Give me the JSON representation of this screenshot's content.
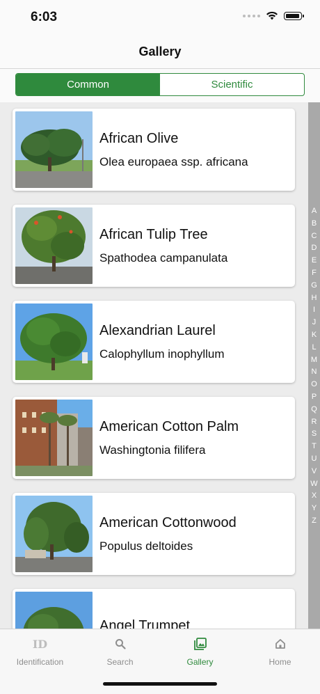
{
  "status": {
    "time": "6:03"
  },
  "nav": {
    "title": "Gallery"
  },
  "segments": [
    {
      "label": "Common",
      "active": true
    },
    {
      "label": "Scientific",
      "active": false
    }
  ],
  "items": [
    {
      "common": "African Olive",
      "scientific": "Olea europaea ssp. africana"
    },
    {
      "common": "African Tulip Tree",
      "scientific": "Spathodea campanulata"
    },
    {
      "common": "Alexandrian Laurel",
      "scientific": "Calophyllum inophyllum"
    },
    {
      "common": "American Cotton Palm",
      "scientific": "Washingtonia filifera"
    },
    {
      "common": "American Cottonwood",
      "scientific": "Populus deltoides"
    },
    {
      "common": "Angel Trumpet",
      "scientific": ""
    }
  ],
  "index_letters": [
    "A",
    "B",
    "C",
    "D",
    "E",
    "F",
    "G",
    "H",
    "I",
    "J",
    "K",
    "L",
    "M",
    "N",
    "O",
    "P",
    "Q",
    "R",
    "S",
    "T",
    "U",
    "V",
    "W",
    "X",
    "Y",
    "Z"
  ],
  "tabs": [
    {
      "label": "Identification",
      "icon": "id-icon",
      "active": false
    },
    {
      "label": "Search",
      "icon": "search-icon",
      "active": false
    },
    {
      "label": "Gallery",
      "icon": "gallery-icon",
      "active": true
    },
    {
      "label": "Home",
      "icon": "home-icon",
      "active": false
    }
  ],
  "colors": {
    "accent": "#2f8a3d",
    "index_bar": "#a9a9a9"
  }
}
